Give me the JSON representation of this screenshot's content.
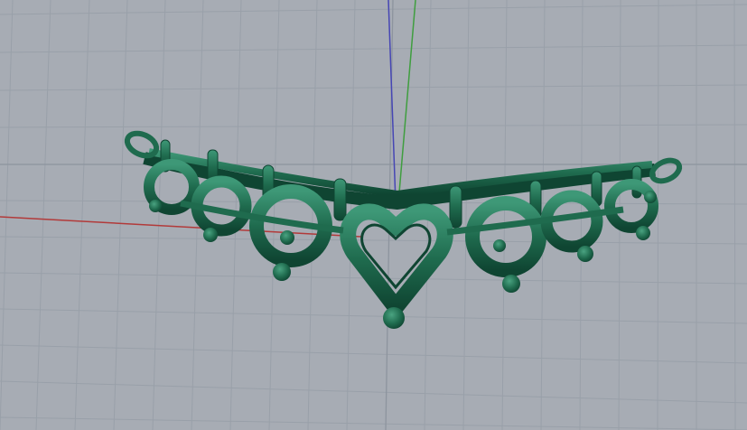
{
  "viewport": {
    "background": "#a7acb4",
    "grid_minor_color": "#99a0a9",
    "grid_major_color": "#8d949e",
    "axis_x_color": "#b23a3a",
    "axis_y_color": "#3f9e3f",
    "axis_z_color": "#4646b4"
  },
  "model": {
    "kind": "jewelry-pendant",
    "material_color": "#1f6b4e",
    "material_highlight": "#3e9877",
    "material_shadow": "#0f4532"
  }
}
